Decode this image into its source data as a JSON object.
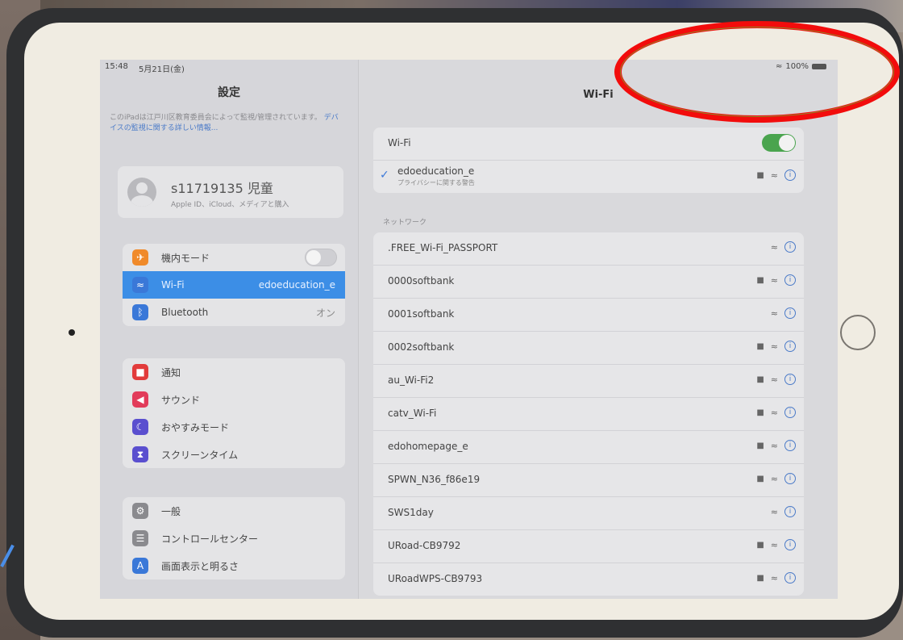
{
  "status": {
    "time": "15:48",
    "date": "5月21日(金)",
    "battery": "100%"
  },
  "sidebar": {
    "title": "設定",
    "mgmt_text": "このiPadは江戸川区教育委員会によって監視/管理されています。",
    "mgmt_link": "デバイスの監視に関する詳しい情報...",
    "profile": {
      "name": "s11719135 児童",
      "subtitle": "Apple ID、iCloud、メディアと購入"
    },
    "group1": [
      {
        "label": "機内モード",
        "value": "",
        "icon": "airplane-icon",
        "color": "#f08a2a"
      },
      {
        "label": "Wi-Fi",
        "value": "edoeducation_e",
        "icon": "wifi-icon",
        "color": "#3a78d8"
      },
      {
        "label": "Bluetooth",
        "value": "オン",
        "icon": "bluetooth-icon",
        "color": "#3a78d8"
      }
    ],
    "group2": [
      {
        "label": "通知",
        "icon": "notification-icon",
        "color": "#e23b3b"
      },
      {
        "label": "サウンド",
        "icon": "sound-icon",
        "color": "#e23b5a"
      },
      {
        "label": "おやすみモード",
        "icon": "moon-icon",
        "color": "#5a4fcf"
      },
      {
        "label": "スクリーンタイム",
        "icon": "hourglass-icon",
        "color": "#5a4fcf"
      }
    ],
    "group3": [
      {
        "label": "一般",
        "icon": "gear-icon",
        "color": "#8a8a8e"
      },
      {
        "label": "コントロールセンター",
        "icon": "control-center-icon",
        "color": "#8a8a8e"
      },
      {
        "label": "画面表示と明るさ",
        "icon": "display-icon",
        "color": "#3a78d8"
      }
    ]
  },
  "main": {
    "title": "Wi-Fi",
    "wifi_label": "Wi-Fi",
    "connected": {
      "name": "edoeducation_e",
      "subtitle": "プライバシーに関する警告"
    },
    "networks_label": "ネットワーク",
    "networks": [
      {
        "name": ".FREE_Wi-Fi_PASSPORT",
        "locked": false
      },
      {
        "name": "0000softbank",
        "locked": true
      },
      {
        "name": "0001softbank",
        "locked": false
      },
      {
        "name": "0002softbank",
        "locked": true
      },
      {
        "name": "au_Wi-Fi2",
        "locked": true
      },
      {
        "name": "catv_Wi-Fi",
        "locked": true
      },
      {
        "name": "edohomepage_e",
        "locked": true
      },
      {
        "name": "SPWN_N36_f86e19",
        "locked": true
      },
      {
        "name": "SWS1day",
        "locked": false
      },
      {
        "name": "URoad-CB9792",
        "locked": true
      },
      {
        "name": "URoadWPS-CB9793",
        "locked": true
      }
    ]
  },
  "glyphs": {
    "wifi": "≈",
    "lock": "■",
    "info": "i",
    "check": "✓",
    "signal": "◆"
  }
}
